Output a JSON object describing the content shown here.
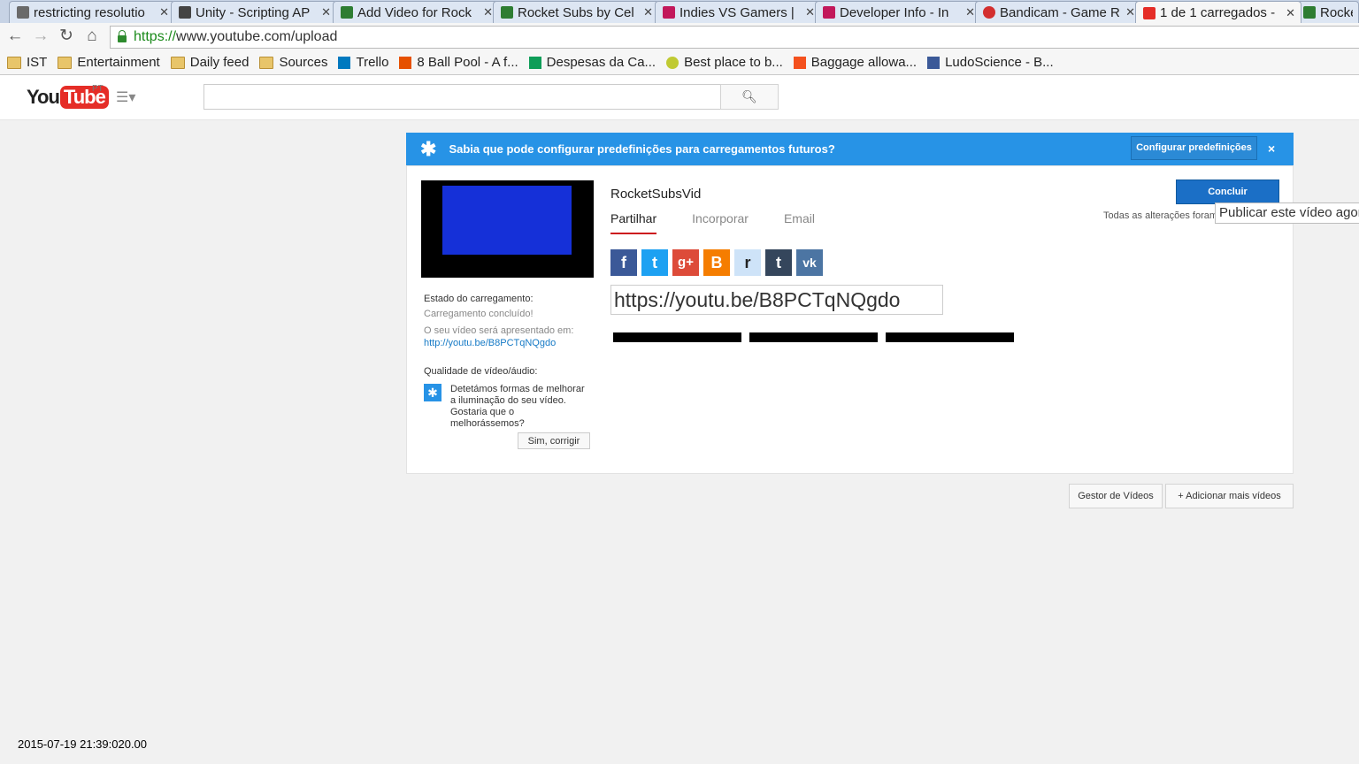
{
  "browser": {
    "tabs": [
      {
        "title": "restricting resolutio",
        "favicon": "stackexchange-icon",
        "color": "#6a6a6a"
      },
      {
        "title": "Unity - Scripting AP",
        "favicon": "unity-icon",
        "color": "#444444"
      },
      {
        "title": "Add Video for Rock",
        "favicon": "game-icon",
        "color": "#2e7d32"
      },
      {
        "title": "Rocket Subs by Cel",
        "favicon": "game-icon",
        "color": "#2e7d32"
      },
      {
        "title": "Indies VS Gamers |",
        "favicon": "calendar-icon",
        "color": "#c2185b"
      },
      {
        "title": "Developer Info - In",
        "favicon": "calendar-icon",
        "color": "#c2185b"
      },
      {
        "title": "Bandicam - Game R",
        "favicon": "record-icon",
        "color": "#d32f2f"
      },
      {
        "title": "1 de 1 carregados -",
        "favicon": "youtube-icon",
        "color": "#e52d27",
        "active": true
      },
      {
        "title": "Rocket",
        "favicon": "game-icon",
        "color": "#2e7d32"
      }
    ],
    "url_scheme": "https://",
    "url_rest": "www.youtube.com/upload",
    "bookmarks": [
      {
        "label": "IST",
        "icon": "folder-icon"
      },
      {
        "label": "Entertainment",
        "icon": "folder-icon"
      },
      {
        "label": "Daily feed",
        "icon": "folder-icon"
      },
      {
        "label": "Sources",
        "icon": "folder-icon"
      },
      {
        "label": "Trello",
        "icon": "trello-icon"
      },
      {
        "label": "8 Ball Pool - A f...",
        "icon": "play-icon"
      },
      {
        "label": "Despesas da Ca...",
        "icon": "sheets-icon"
      },
      {
        "label": "Best place to b...",
        "icon": "smiley-icon"
      },
      {
        "label": "Baggage allowa...",
        "icon": "e-icon"
      },
      {
        "label": "LudoScience - B...",
        "icon": "facebook-icon"
      }
    ]
  },
  "youtube": {
    "logo_you": "You",
    "logo_tube": "Tube",
    "logo_country": "PT",
    "search_placeholder": ""
  },
  "banner": {
    "text": "Sabia que pode configurar predefinições para carregamentos futuros?",
    "button": "Configurar predefinições",
    "close": "×"
  },
  "upload": {
    "status_label": "Estado do carregamento:",
    "status_value": "Carregamento concluído!",
    "presented_label": "O seu vídeo será apresentado em:",
    "video_link": "http://youtu.be/B8PCTqNQgdo",
    "quality_label": "Qualidade de vídeo/áudio:",
    "quality_text": "Detetámos formas de melhorar a iluminação do seu vídeo. Gostaria que o melhorássemos?",
    "fix_button": "Sim, corrigir",
    "video_title": "RocketSubsVid",
    "tabs": [
      "Partilhar",
      "Incorporar",
      "Email"
    ],
    "done_button": "Concluir",
    "saved_text": "Todas as alterações foram",
    "tooltip": "Publicar este vídeo agora",
    "share_url": "https://youtu.be/B8PCTqNQgdo",
    "social": [
      {
        "name": "facebook",
        "glyph": "f",
        "color": "#3b5998"
      },
      {
        "name": "twitter",
        "glyph": "t",
        "color": "#1da1f2"
      },
      {
        "name": "googleplus",
        "glyph": "g+",
        "color": "#dd4b39"
      },
      {
        "name": "blogger",
        "glyph": "B",
        "color": "#f57d00"
      },
      {
        "name": "reddit",
        "glyph": "r",
        "color": "#cee3f8"
      },
      {
        "name": "tumblr",
        "glyph": "t",
        "color": "#35465c"
      },
      {
        "name": "vk",
        "glyph": "vk",
        "color": "#4c75a3"
      }
    ]
  },
  "footer_buttons": {
    "manager": "Gestor de Vídeos",
    "add_more": "+ Adicionar mais vídeos"
  },
  "timestamp": "2015-07-19 21:39:020.00"
}
